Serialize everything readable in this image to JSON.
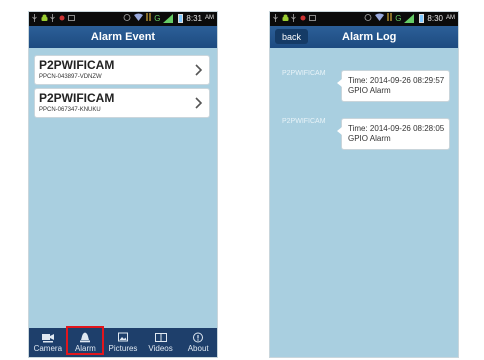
{
  "alarm_event_screen": {
    "status": {
      "time": "8:31",
      "ampm": "AM",
      "carrier": "G"
    },
    "title": "Alarm Event",
    "devices": [
      {
        "name": "P2PWIFICAM",
        "id": "PPCN-043897-VDNZW"
      },
      {
        "name": "P2PWIFICAM",
        "id": "PPCN-067347-KNUKU"
      }
    ],
    "tabs": [
      {
        "label": "Camera",
        "icon": "camera-icon"
      },
      {
        "label": "Alarm",
        "icon": "alarm-bell-icon",
        "active": true
      },
      {
        "label": "Pictures",
        "icon": "pictures-icon"
      },
      {
        "label": "Videos",
        "icon": "videos-icon"
      },
      {
        "label": "About",
        "icon": "about-icon"
      }
    ]
  },
  "alarm_log_screen": {
    "status": {
      "time": "8:30",
      "ampm": "AM",
      "carrier": "G"
    },
    "back_label": "back",
    "title": "Alarm Log",
    "entries": [
      {
        "device": "P2PWIFICAM",
        "time": "Time: 2014-09-26 08:29:57",
        "type": "GPIO Alarm"
      },
      {
        "device": "P2PWIFICAM",
        "time": "Time: 2014-09-26 08:28:05",
        "type": "GPIO Alarm"
      }
    ]
  },
  "colors": {
    "accent": "#1d4b80",
    "background": "#a9cfe0",
    "highlight": "#e2161d"
  }
}
